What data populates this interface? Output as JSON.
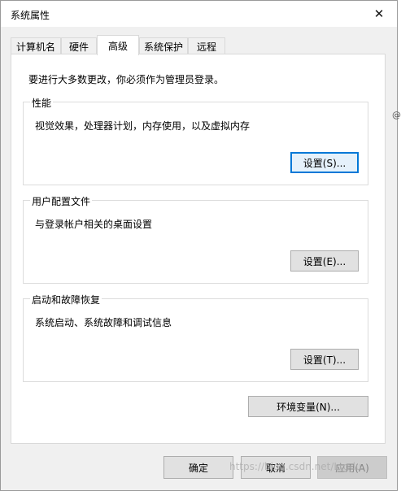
{
  "window": {
    "title": "系统属性"
  },
  "tabs": [
    {
      "label": "计算机名",
      "active": false
    },
    {
      "label": "硬件",
      "active": false
    },
    {
      "label": "高级",
      "active": true
    },
    {
      "label": "系统保护",
      "active": false
    },
    {
      "label": "远程",
      "active": false
    }
  ],
  "advanced": {
    "admin_notice": "要进行大多数更改，你必须作为管理员登录。",
    "performance": {
      "title": "性能",
      "description": "视觉效果，处理器计划，内存使用，以及虚拟内存",
      "button": "设置(S)..."
    },
    "user_profiles": {
      "title": "用户配置文件",
      "description": "与登录帐户相关的桌面设置",
      "button": "设置(E)..."
    },
    "startup_recovery": {
      "title": "启动和故障恢复",
      "description": "系统启动、系统故障和调试信息",
      "button": "设置(T)..."
    },
    "env_button": "环境变量(N)..."
  },
  "footer": {
    "ok": "确定",
    "cancel": "取消",
    "apply": "应用(A)"
  },
  "watermark": "https://blog.csdn.net/Ltgdu",
  "edge_fragment": "@"
}
